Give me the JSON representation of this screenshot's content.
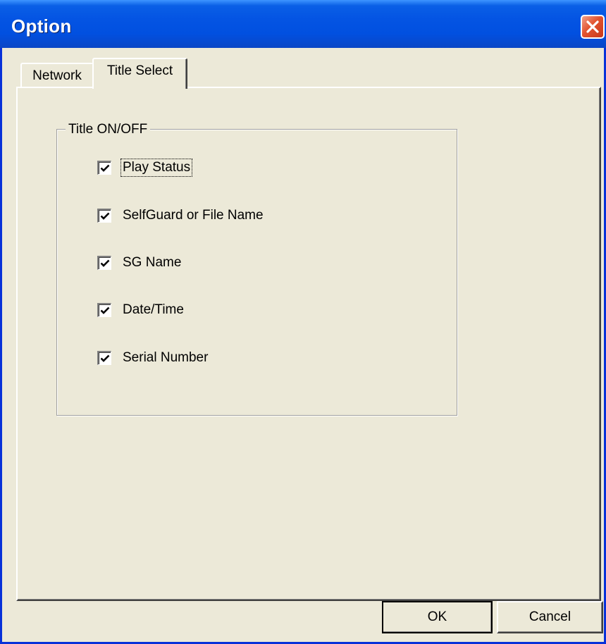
{
  "window": {
    "title": "Option",
    "close_label": "Close"
  },
  "tabs": [
    {
      "label": "Network",
      "active": false
    },
    {
      "label": "Title Select",
      "active": true
    }
  ],
  "group": {
    "legend": "Title ON/OFF",
    "items": [
      {
        "label": "Play Status",
        "checked": true,
        "focused": true
      },
      {
        "label": "SelfGuard or File Name",
        "checked": true,
        "focused": false
      },
      {
        "label": "SG Name",
        "checked": true,
        "focused": false
      },
      {
        "label": "Date/Time",
        "checked": true,
        "focused": false
      },
      {
        "label": "Serial Number",
        "checked": true,
        "focused": false
      }
    ]
  },
  "buttons": {
    "ok": "OK",
    "cancel": "Cancel"
  },
  "colors": {
    "titlebar": "#0454e3",
    "dialog_bg": "#ece9d8",
    "close_button": "#e2532f"
  }
}
